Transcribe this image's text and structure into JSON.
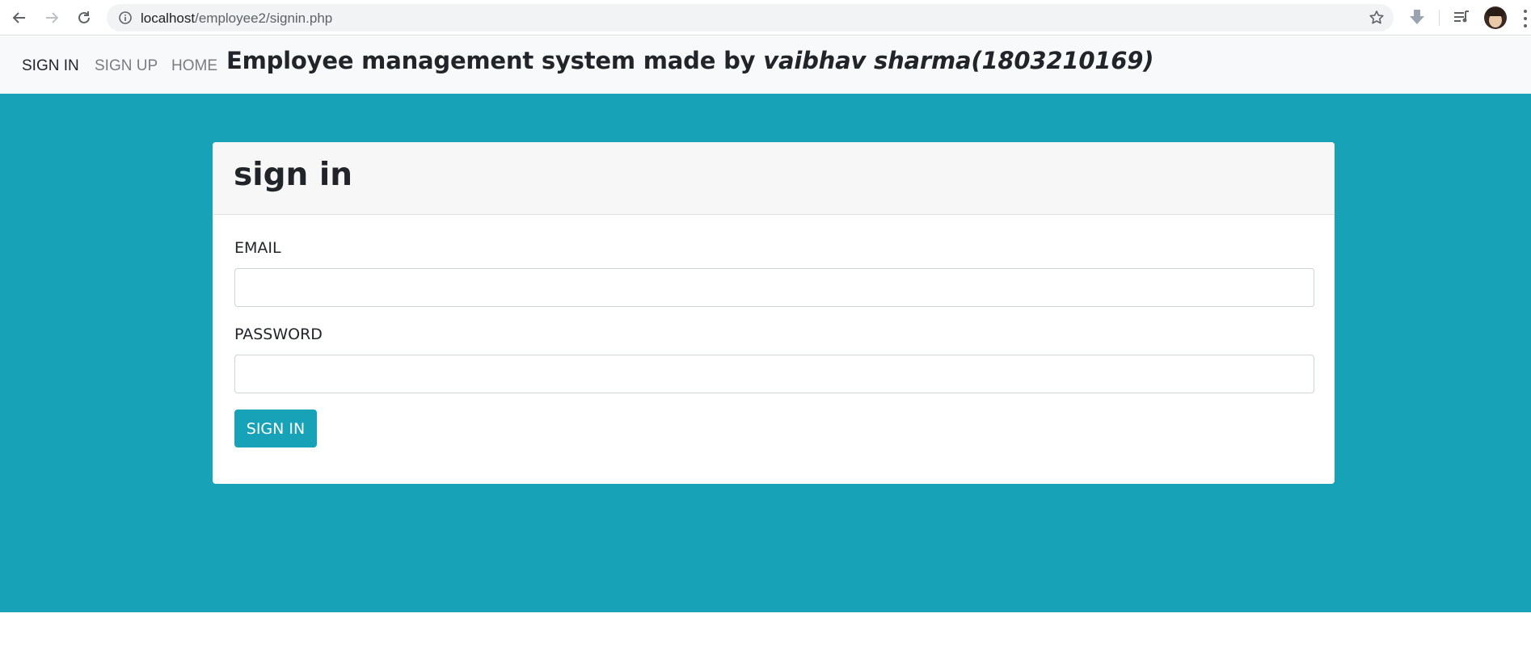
{
  "browser": {
    "url_host": "localhost",
    "url_path": "/employee2/signin.php"
  },
  "navbar": {
    "links": [
      {
        "label": "SIGN IN",
        "active": true
      },
      {
        "label": "SIGN UP",
        "active": false
      },
      {
        "label": "HOME",
        "active": false
      }
    ],
    "brand_prefix": "Employee management system made by ",
    "brand_author": "vaibhav sharma(1803210169)"
  },
  "card": {
    "title": "sign in",
    "email_label": "EMAIL",
    "email_value": "",
    "password_label": "PASSWORD",
    "password_value": "",
    "submit_label": "SIGN IN"
  },
  "colors": {
    "accent": "#17a2b8",
    "navbar_bg": "#f8f9fa",
    "card_header_bg": "#f7f7f7"
  },
  "icons": {
    "back": "arrow-left-icon",
    "forward": "arrow-right-icon",
    "reload": "reload-icon",
    "info": "info-icon",
    "bookmark": "star-icon",
    "download_ext": "download-arrow-icon",
    "media_ext": "playlist-icon",
    "profile": "avatar",
    "menu": "kebab-menu-icon"
  }
}
